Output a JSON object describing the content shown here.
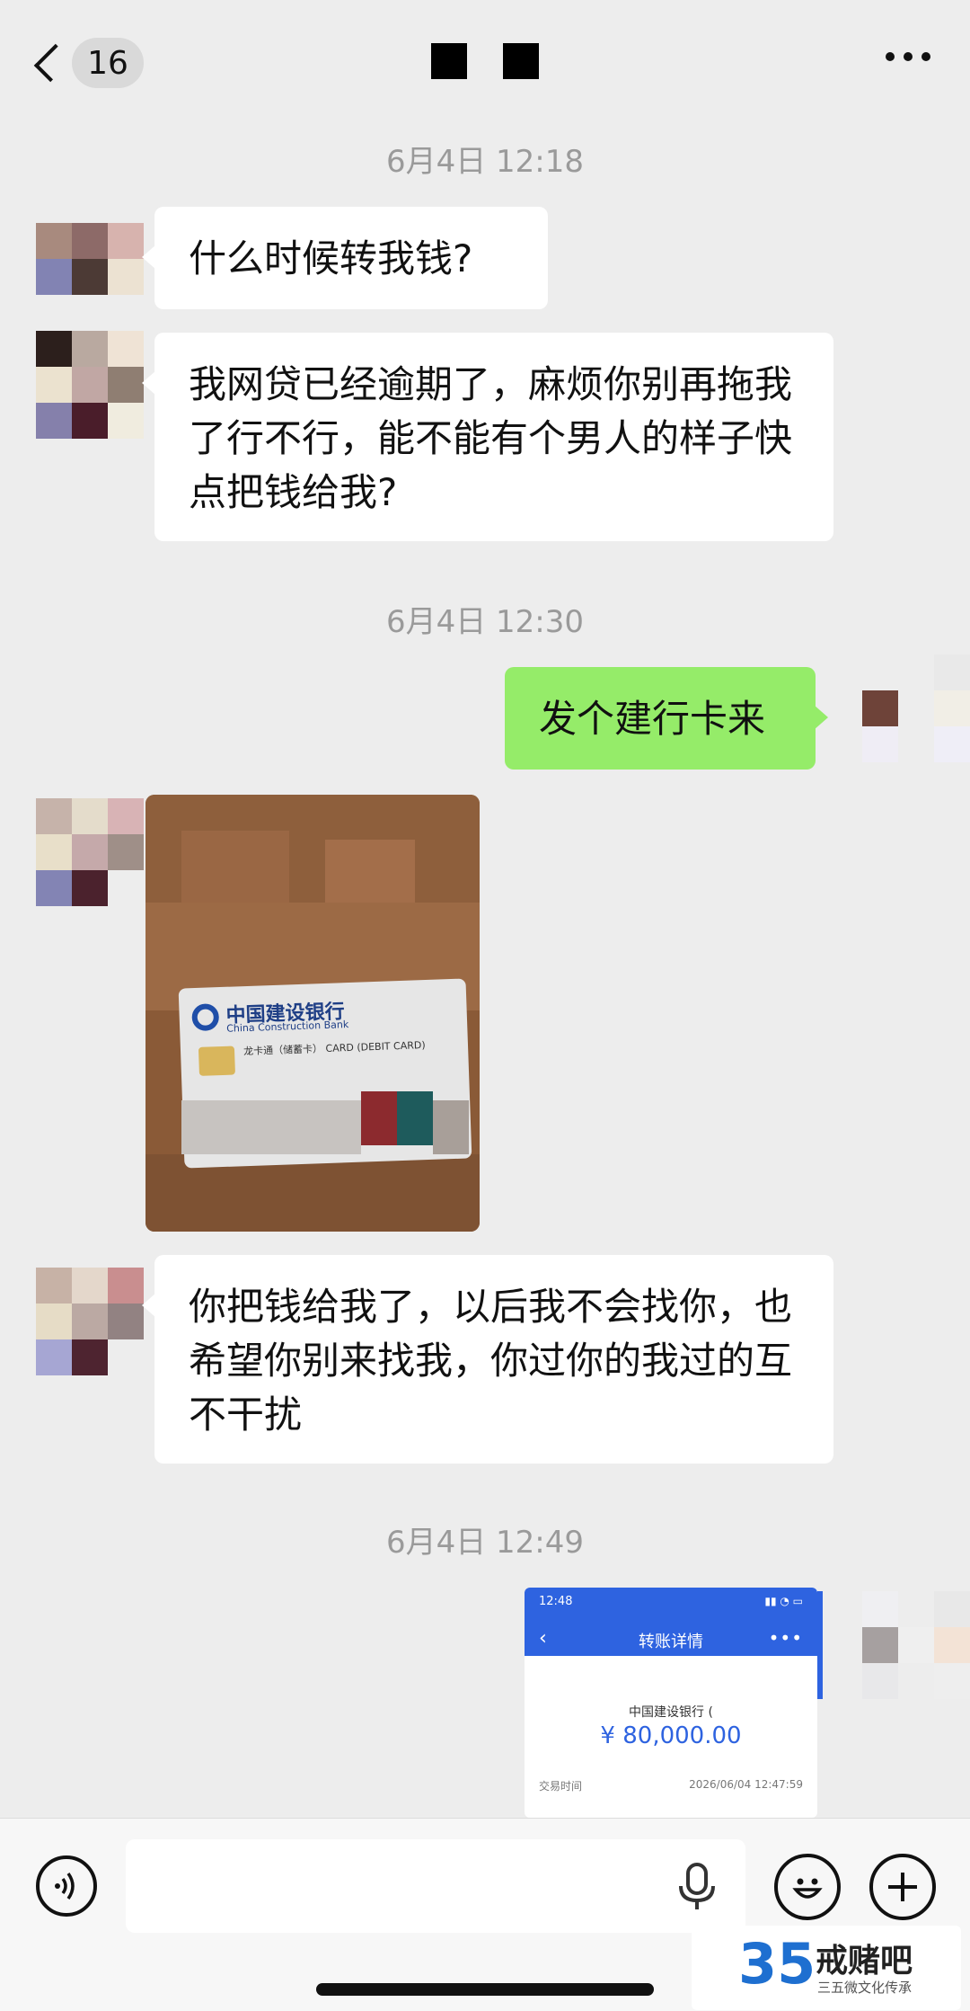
{
  "header": {
    "unread_count": "16"
  },
  "messages": [
    {
      "type": "timestamp",
      "text": "6月4日 12:18"
    },
    {
      "type": "text",
      "side": "left",
      "text": "什么时候转我钱?"
    },
    {
      "type": "text",
      "side": "left",
      "text": "我网贷已经逾期了，麻烦你别再拖我了行不行，能不能有个男人的样子快点把钱给我?"
    },
    {
      "type": "timestamp",
      "text": "6月4日 12:30"
    },
    {
      "type": "text",
      "side": "right",
      "text": "发个建行卡来"
    },
    {
      "type": "image",
      "side": "left",
      "bank_name": "中国建设银行",
      "bank_name_en": "China Construction Bank",
      "card_text": "龙卡通（储蓄卡） CARD (DEBIT CARD)"
    },
    {
      "type": "text",
      "side": "left",
      "text": "你把钱给我了，以后我不会找你，也希望你别来找我，你过你的我过的互不干扰"
    },
    {
      "type": "timestamp",
      "text": "6月4日 12:49"
    },
    {
      "type": "image",
      "side": "right",
      "status_time": "12:48",
      "title": "转账详情",
      "bank": "中国建设银行 (",
      "amount": "¥ 80,000.00",
      "row_label": "交易时间",
      "row_value": "2026/06/04 12:47:59"
    }
  ],
  "watermark": {
    "number": "35",
    "name": "戒赌吧",
    "subtitle": "三五微文化传承"
  }
}
